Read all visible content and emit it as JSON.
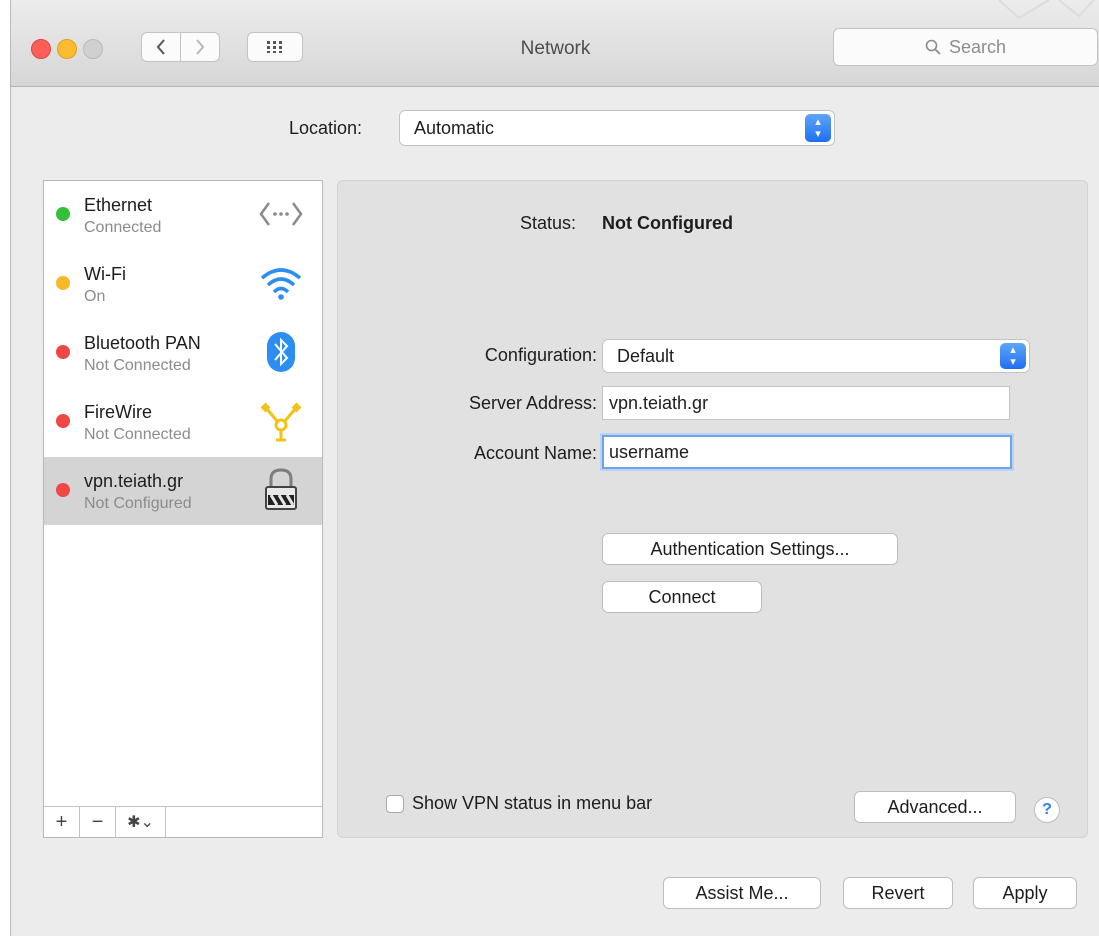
{
  "window": {
    "title": "Network",
    "search_placeholder": "Search"
  },
  "location": {
    "label": "Location:",
    "value": "Automatic"
  },
  "services": [
    {
      "name": "Ethernet",
      "status": "Connected",
      "dot": "#35c037",
      "icon": "ethernet-icon"
    },
    {
      "name": "Wi-Fi",
      "status": "On",
      "dot": "#f7b928",
      "icon": "wifi-icon"
    },
    {
      "name": "Bluetooth PAN",
      "status": "Not Connected",
      "dot": "#ef4646",
      "icon": "bluetooth-icon"
    },
    {
      "name": "FireWire",
      "status": "Not Connected",
      "dot": "#ef4646",
      "icon": "firewire-icon"
    },
    {
      "name": "vpn.teiath.gr",
      "status": "Not Configured",
      "dot": "#ef4646",
      "icon": "vpn-lock-icon",
      "selected": true
    }
  ],
  "detail": {
    "status_label": "Status:",
    "status_value": "Not Configured",
    "configuration_label": "Configuration:",
    "configuration_value": "Default",
    "server_label": "Server Address:",
    "server_value": "vpn.teiath.gr",
    "account_label": "Account Name:",
    "account_value": "username",
    "auth_button": "Authentication Settings...",
    "connect_button": "Connect",
    "show_vpn_label": "Show VPN status in menu bar",
    "show_vpn_checked": false,
    "advanced_button": "Advanced...",
    "help": "?"
  },
  "footer": {
    "assist": "Assist Me...",
    "revert": "Revert",
    "apply": "Apply"
  },
  "colors": {
    "accent": "#2f7cf6",
    "window_bg": "#ececec",
    "selected_row": "#d4d4d4"
  }
}
